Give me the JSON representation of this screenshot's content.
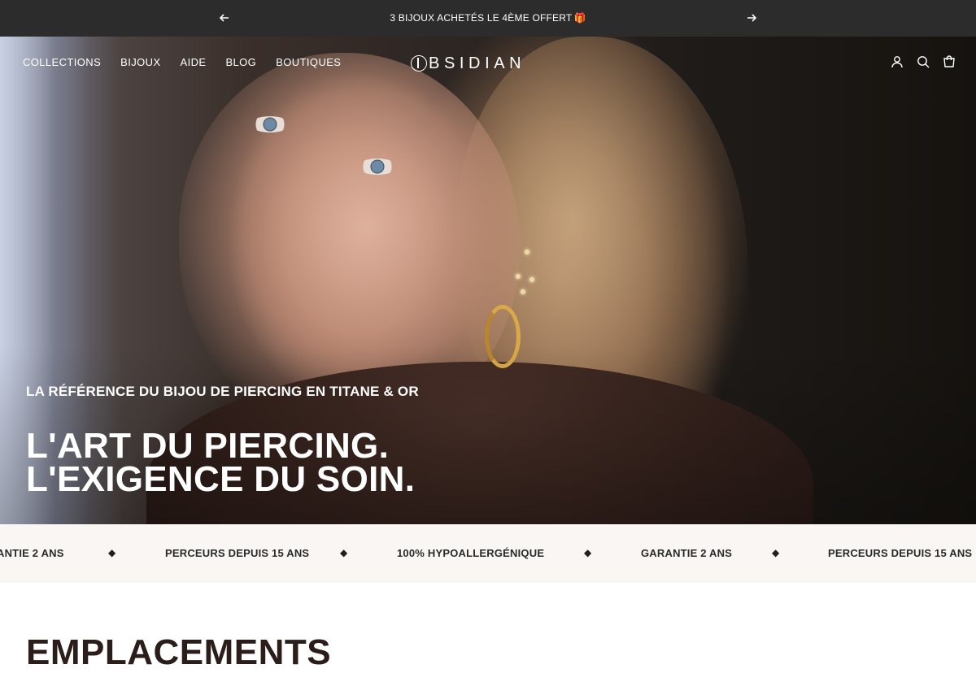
{
  "announcement": {
    "message": "3 BIJOUX ACHETÉS LE 4ÈME OFFERT",
    "gift_icon": "🎁",
    "prev_icon": "arrow-left-icon",
    "next_icon": "arrow-right-icon"
  },
  "nav": {
    "links": [
      "COLLECTIONS",
      "BIJOUX",
      "AIDE",
      "BLOG",
      "BOUTIQUES"
    ],
    "logo_text": "BSIDIAN",
    "icons": [
      "account-icon",
      "search-icon",
      "cart-icon"
    ]
  },
  "hero": {
    "kicker": "LA RÉFÉRENCE DU BIJOU DE PIERCING EN TITANE & OR",
    "headline_line1": "L'ART DU PIERCING.",
    "headline_line2": "L'EXIGENCE DU SOIN."
  },
  "marquee": {
    "items": [
      "ANTIE 2 ANS",
      "PERCEURS DEPUIS 15 ANS",
      "100% HYPOALLERGÉNIQUE",
      "GARANTIE 2 ANS",
      "PERCEURS DEPUIS 15 ANS"
    ],
    "separator": "◆"
  },
  "section": {
    "title": "EMPLACEMENTS"
  },
  "colors": {
    "announcement_bg": "#2c2c2c",
    "marquee_bg": "#f9f6f3",
    "text_dark": "#2a1d1a"
  }
}
